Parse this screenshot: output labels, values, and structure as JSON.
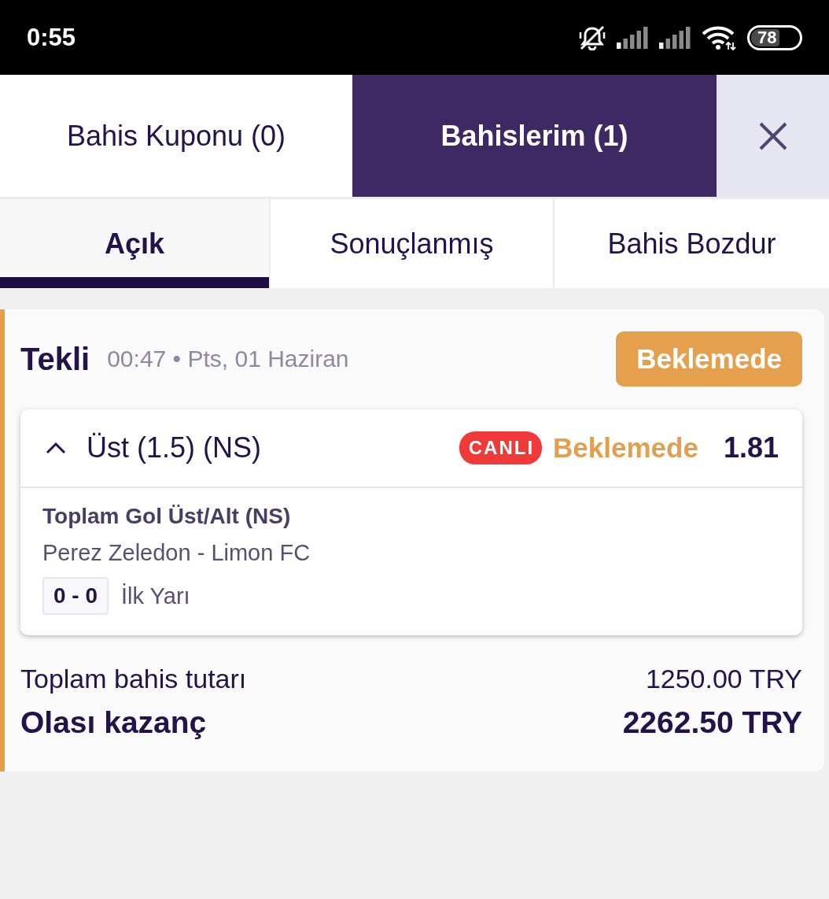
{
  "status_bar": {
    "time": "0:55",
    "battery": "78"
  },
  "top_tabs": [
    {
      "label": "Bahis Kuponu (0)",
      "selected": false
    },
    {
      "label": "Bahislerim (1)",
      "selected": true
    }
  ],
  "sub_tabs": [
    {
      "label": "Açık",
      "selected": true
    },
    {
      "label": "Sonuçlanmış",
      "selected": false
    },
    {
      "label": "Bahis Bozdur",
      "selected": false
    }
  ],
  "bet": {
    "type": "Tekli",
    "meta": "00:47 • Pts, 01 Haziran",
    "status": "Beklemede",
    "selection": {
      "name": "Üst (1.5) (NS)",
      "expanded": true,
      "live_badge": "CANLI",
      "status": "Beklemede",
      "odds": "1.81",
      "market": "Toplam Gol Üst/Alt (NS)",
      "match": "Perez Zeledon - Limon FC",
      "score": "0 - 0",
      "period": "İlk Yarı"
    },
    "summary": [
      {
        "label": "Toplam bahis tutarı",
        "value": "1250.00 TRY",
        "kind": "normal"
      },
      {
        "label": "Olası kazanç",
        "value": "2262.50 TRY",
        "kind": "total"
      }
    ]
  }
}
